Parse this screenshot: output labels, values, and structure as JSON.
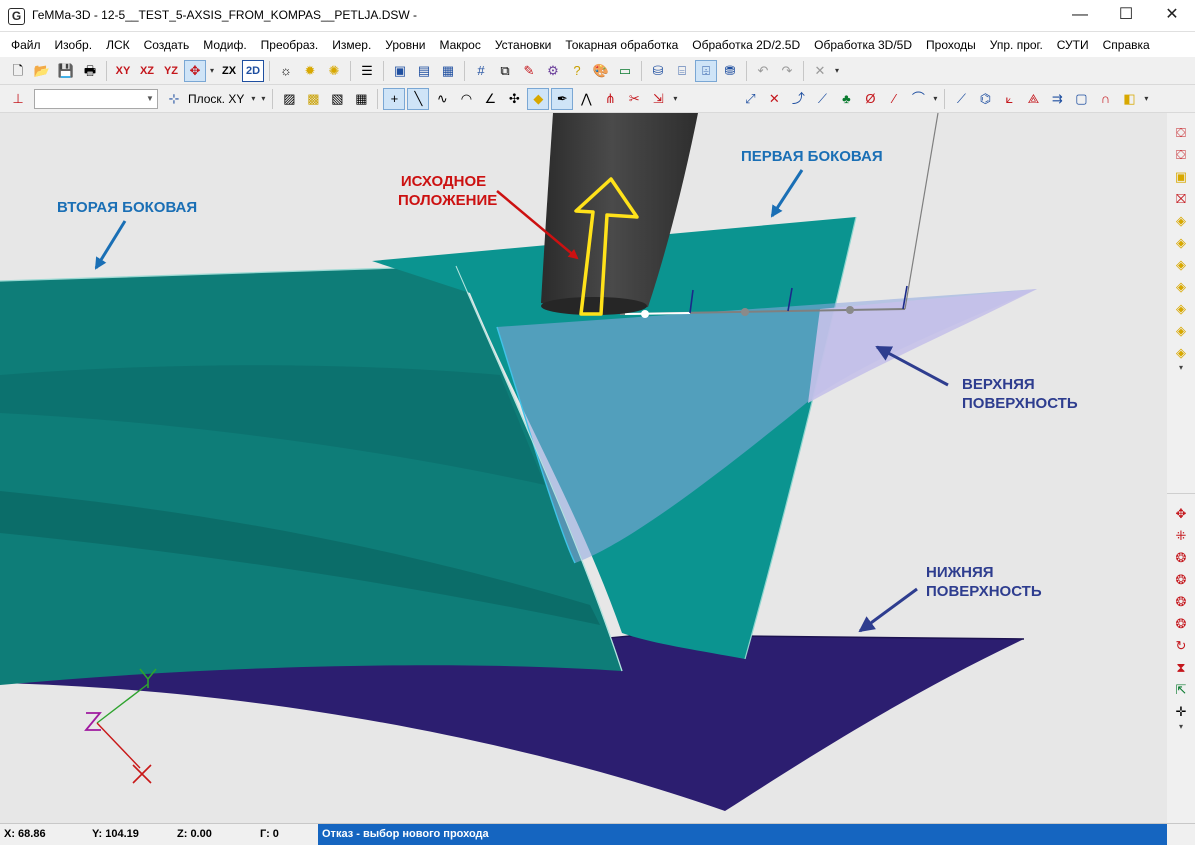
{
  "window": {
    "title": "ГеММа-3D - 12-5__TEST_5-AXSIS_FROM_KOMPAS__PETLJA.DSW -",
    "app_icon_letter": "G",
    "minimize_glyph": "—",
    "maximize_glyph": "☐",
    "close_glyph": "✕"
  },
  "menu": [
    "Файл",
    "Изобр.",
    "ЛСК",
    "Создать",
    "Модиф.",
    "Преобраз.",
    "Измер.",
    "Уровни",
    "Макрос",
    "Установки",
    "Токарная обработка",
    "Обработка 2D/2.5D",
    "Обработка 3D/5D",
    "Проходы",
    "Упр. прог.",
    "СУТИ",
    "Справка"
  ],
  "toolbar1": {
    "view_xy": "XY",
    "view_xz": "XZ",
    "view_yz": "YZ",
    "view_zx": "ZX",
    "view_2d": "2D"
  },
  "toolbar2": {
    "level_combo_value": "",
    "plane_label": "Плоск. XY"
  },
  "viewport": {
    "annotations": {
      "initial_position": [
        "ИСХОДНОЕ",
        "ПОЛОЖЕНИЕ"
      ],
      "first_side": "ПЕРВАЯ БОКОВАЯ",
      "second_side": "ВТОРАЯ БОКОВАЯ",
      "upper_surface": [
        "ВЕРХНЯЯ",
        "ПОВЕРХНОСТЬ"
      ],
      "lower_surface": [
        "НИЖНЯЯ",
        "ПОВЕРХНОСТЬ"
      ]
    },
    "colors": {
      "background": "#e7e7e7",
      "annotation_red": "#cc1111",
      "annotation_blue": "#1a6fb5",
      "annotation_navy": "#2e3d8f",
      "surface_teal": "#0e7d78",
      "surface_teal_light": "#0b9490",
      "surface_upper": "#b6b3dd",
      "surface_lower": "#2c1e70",
      "tool": "#3c3c3c",
      "arrow_yellow": "#ffe21a"
    },
    "axis_labels": {
      "y": "Y",
      "z": "Z"
    }
  },
  "status": {
    "x": "X: 68.86",
    "y": "Y: 104.19",
    "z": "Z: 0.00",
    "g": "Г: 0",
    "message": "Отказ - выбор нового прохода"
  }
}
